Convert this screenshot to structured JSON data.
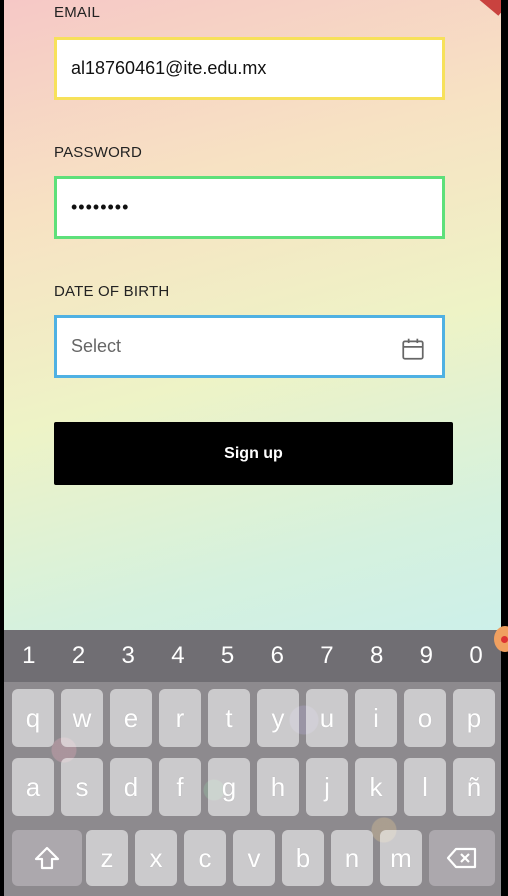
{
  "form": {
    "email_label": "EMAIL",
    "email_value": "al18760461@ite.edu.mx",
    "password_label": "PASSWORD",
    "password_value": "••••••••",
    "dob_label": "DATE OF BIRTH",
    "dob_placeholder": "Select",
    "signup_label": "Sign up"
  },
  "keyboard": {
    "numbers": [
      "1",
      "2",
      "3",
      "4",
      "5",
      "6",
      "7",
      "8",
      "9",
      "0"
    ],
    "row1": [
      "q",
      "w",
      "e",
      "r",
      "t",
      "y",
      "u",
      "i",
      "o",
      "p"
    ],
    "row2": [
      "a",
      "s",
      "d",
      "f",
      "g",
      "h",
      "j",
      "k",
      "l",
      "ñ"
    ],
    "row3": [
      "z",
      "x",
      "c",
      "v",
      "b",
      "n",
      "m"
    ],
    "shift_icon": "shift-arrow-icon",
    "backspace_icon": "backspace-icon"
  },
  "colors": {
    "email_border": "#f7e15a",
    "password_border": "#5ee07a",
    "dob_border": "#4fb1e3",
    "button_bg": "#000000"
  }
}
